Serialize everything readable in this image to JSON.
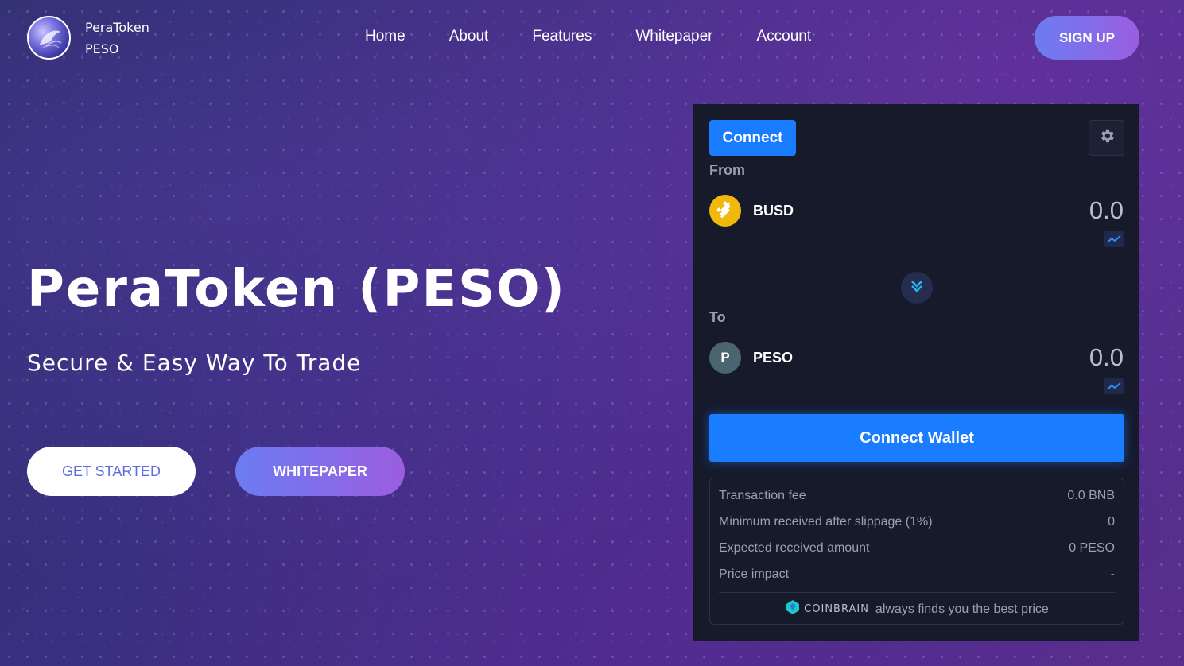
{
  "brand": {
    "name": "PeraToken",
    "ticker": "PESO"
  },
  "nav": {
    "items": [
      "Home",
      "About",
      "Features",
      "Whitepaper",
      "Account"
    ],
    "signup_label": "SIGN UP"
  },
  "hero": {
    "title": "PeraToken (PESO)",
    "subtitle": "Secure & Easy Way To Trade",
    "get_started_label": "GET STARTED",
    "whitepaper_label": "WHITEPAPER"
  },
  "swap": {
    "connect_label": "Connect",
    "from_label": "From",
    "from_token": "BUSD",
    "from_amount": "0.0",
    "to_label": "To",
    "to_token": "PESO",
    "to_token_initial": "P",
    "to_amount": "0.0",
    "connect_wallet_label": "Connect Wallet",
    "info": [
      {
        "label": "Transaction fee",
        "value": "0.0 BNB"
      },
      {
        "label": "Minimum received after slippage (1%)",
        "value": "0"
      },
      {
        "label": "Expected received amount",
        "value": "0 PESO"
      },
      {
        "label": "Price impact",
        "value": "-"
      }
    ],
    "provider_name": "COINBRAIN",
    "provider_tagline": "always finds you the best price"
  },
  "colors": {
    "accent_blue": "#1a7cff",
    "gradient_start": "#6c7cf2",
    "gradient_end": "#9a5ee0",
    "busd_yellow": "#f0b90b",
    "peso_gray": "#4a6470"
  }
}
